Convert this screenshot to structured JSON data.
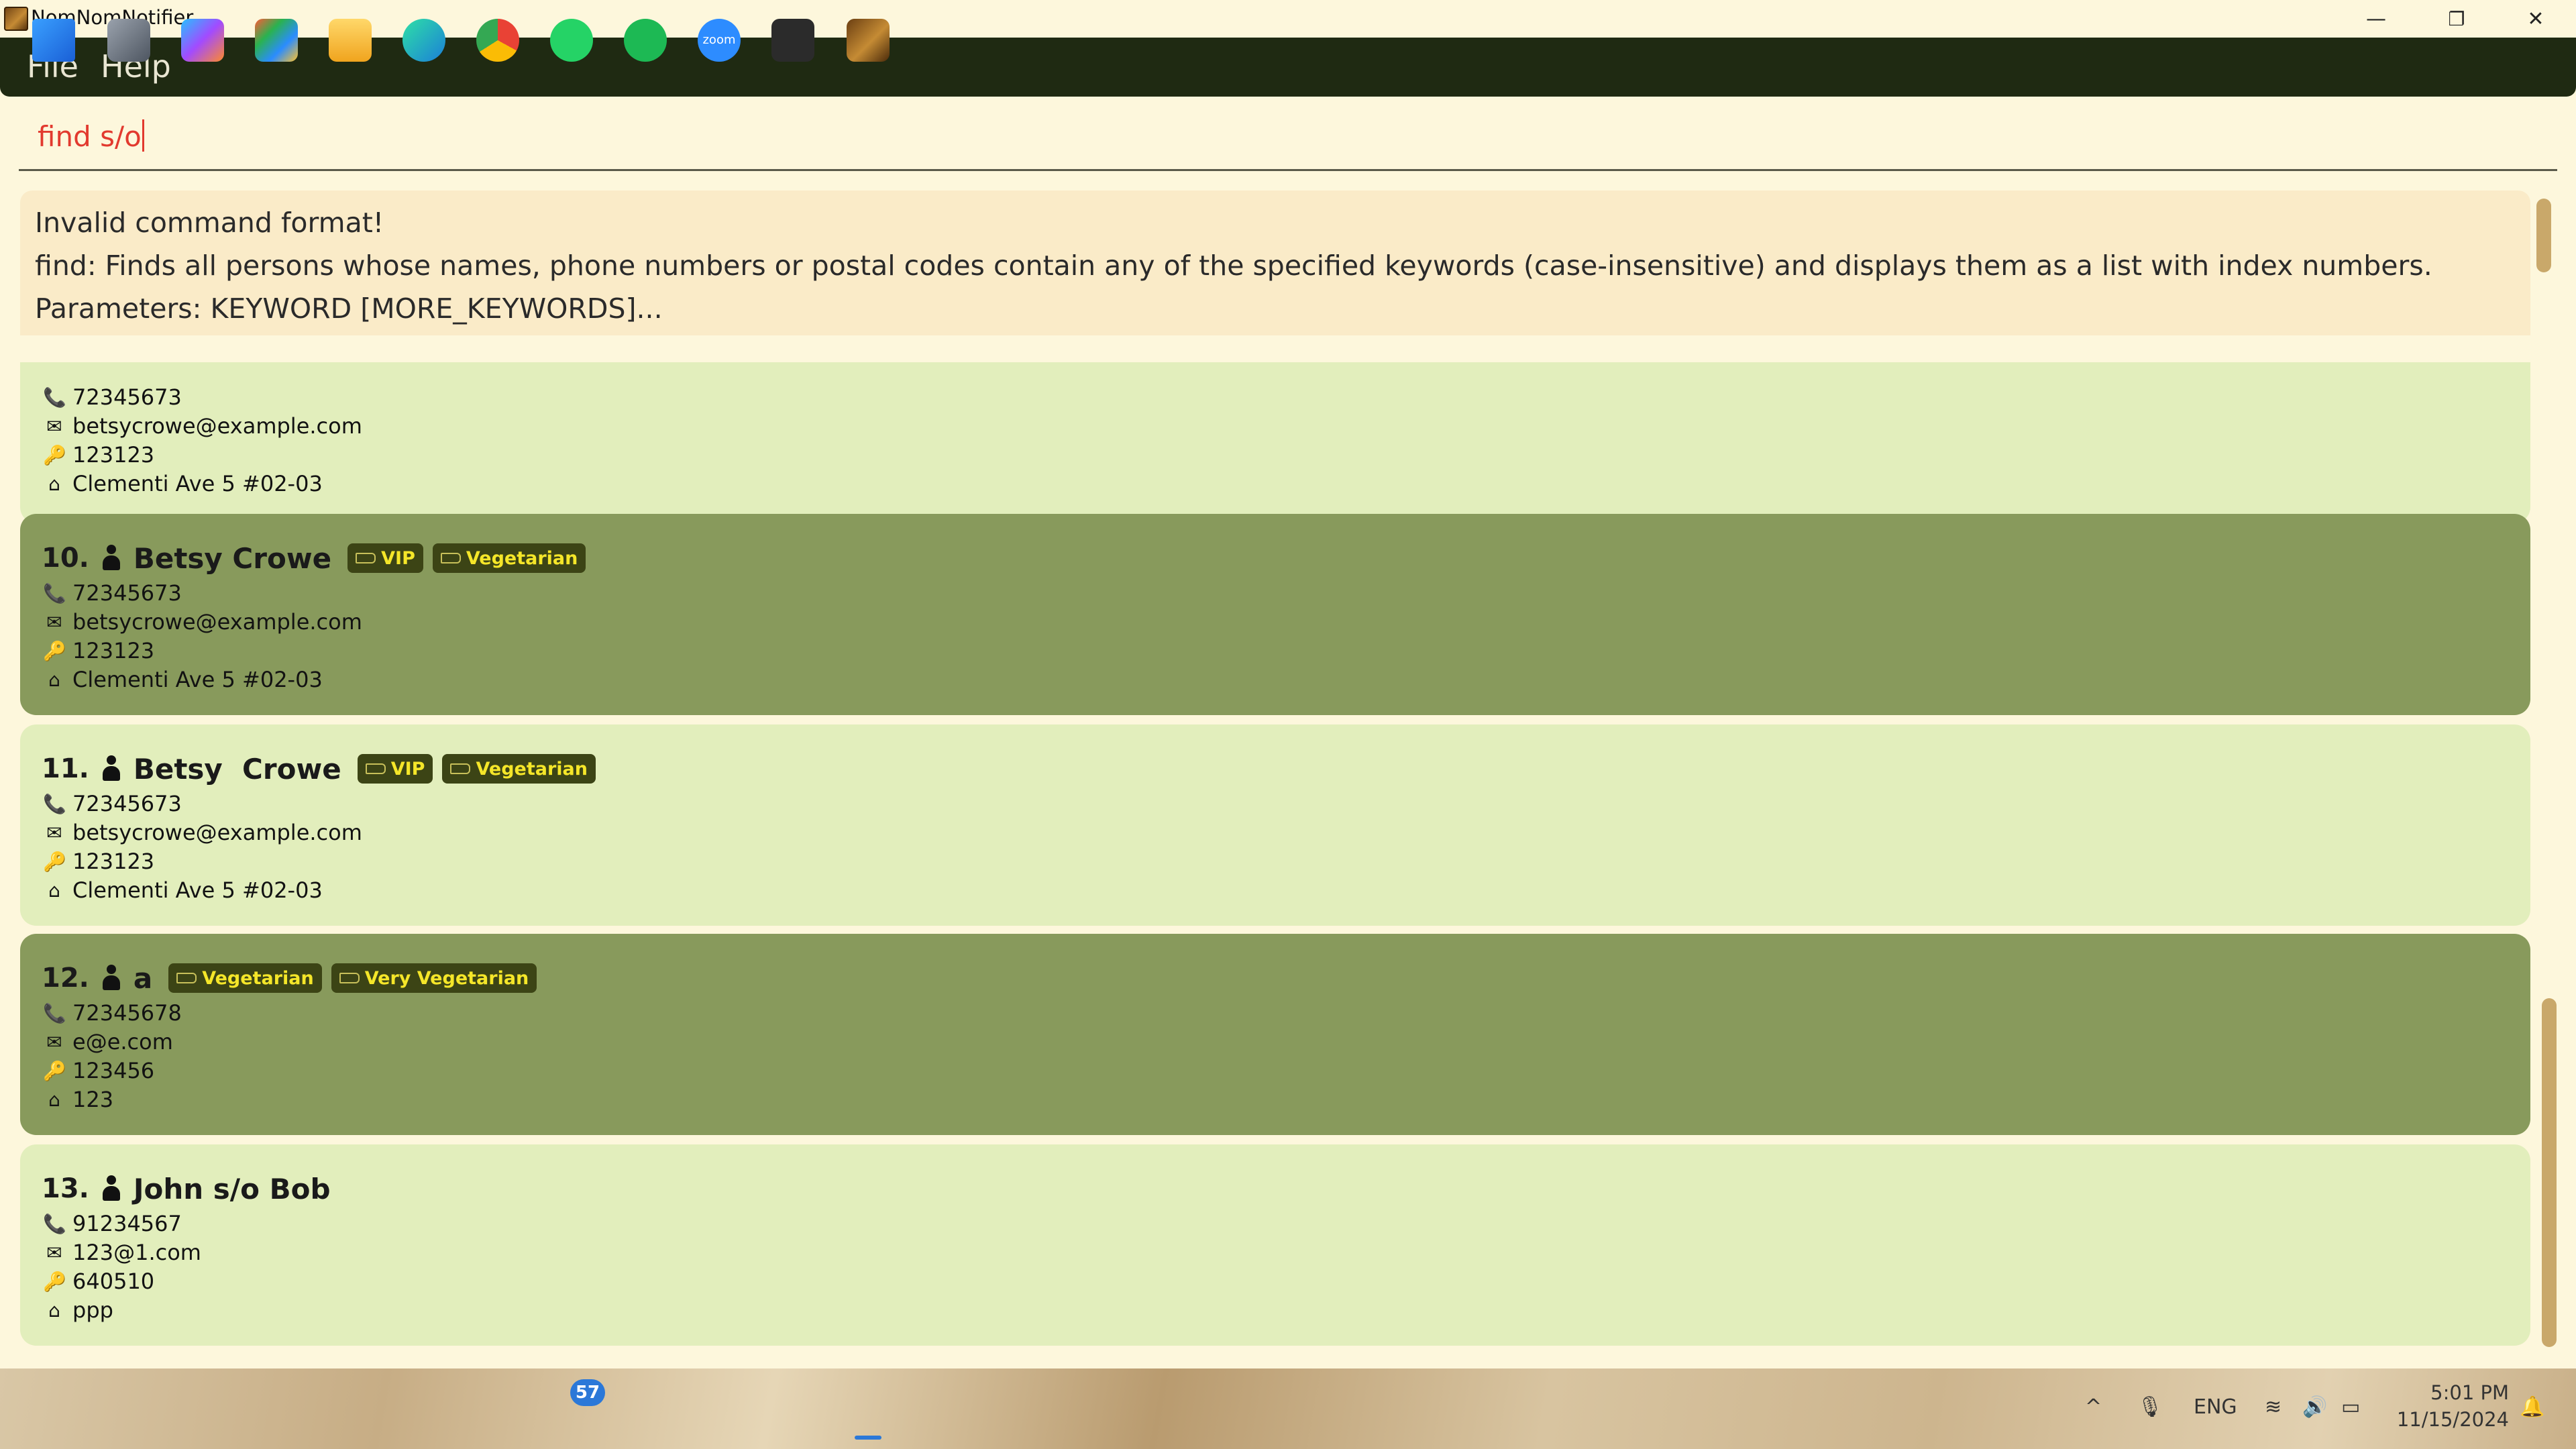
{
  "window": {
    "title": "NomNomNotifier",
    "controls": {
      "minimize": "—",
      "restore": "❐",
      "close": "✕"
    }
  },
  "menu": {
    "file": "File",
    "help": "Help"
  },
  "command": {
    "value": "find s/o"
  },
  "result": {
    "lines": [
      "Invalid command format!",
      "find: Finds all persons whose names, phone numbers or postal codes contain any of the specified keywords (case-insensitive) and displays them as a list with index numbers.",
      "Parameters: KEYWORD [MORE_KEYWORDS]..."
    ]
  },
  "persons": [
    {
      "index": "",
      "name": "",
      "tags": [],
      "phone": "72345673",
      "email": "betsycrowe@example.com",
      "postal": "123123",
      "address": "Clementi Ave 5 #02-03"
    },
    {
      "index": "10.",
      "name": "Betsy Crowe",
      "tags": [
        "VIP",
        "Vegetarian"
      ],
      "phone": "72345673",
      "email": "betsycrowe@example.com",
      "postal": "123123",
      "address": "Clementi Ave 5 #02-03"
    },
    {
      "index": "11.",
      "name": "Betsy  Crowe",
      "tags": [
        "VIP",
        "Vegetarian"
      ],
      "phone": "72345673",
      "email": "betsycrowe@example.com",
      "postal": "123123",
      "address": "Clementi Ave 5 #02-03"
    },
    {
      "index": "12.",
      "name": "a",
      "tags": [
        "Vegetarian",
        "Very Vegetarian"
      ],
      "phone": "72345678",
      "email": "e@e.com",
      "postal": "123456",
      "address": "123"
    },
    {
      "index": "13.",
      "name": "John s/o Bob",
      "tags": [],
      "phone": "91234567",
      "email": "123@1.com",
      "postal": "640510",
      "address": "ppp"
    }
  ],
  "colors": {
    "card_light": "#e2eebc",
    "card_dark": "#889a5c",
    "menubar": "#1f2a12",
    "command_text": "#e23a2f",
    "tag_bg": "#3c4415",
    "tag_text": "#f5e629"
  },
  "taskbar": {
    "icons": [
      "windows-start-icon",
      "task-view-icon",
      "copilot-icon",
      "microsoft-store-icon",
      "file-explorer-icon",
      "edge-icon",
      "chrome-icon",
      "whatsapp-icon",
      "spotify-icon",
      "zoom-icon",
      "terminal-icon",
      "nomnomnotifier-icon"
    ],
    "whatsapp_badge": "57",
    "zoom_label": "zoom",
    "language": "ENG",
    "time": "5:01 PM",
    "date": "11/15/2024"
  }
}
